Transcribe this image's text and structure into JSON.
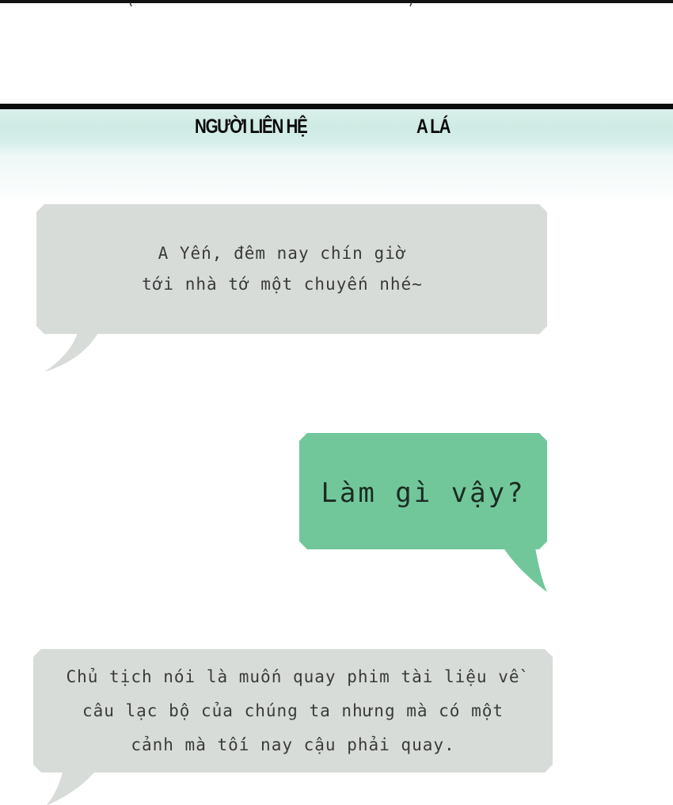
{
  "header": {
    "contact_label": "NGƯỜI LIÊN HỆ",
    "contact_name": "A LÁ"
  },
  "messages": [
    {
      "sender": "contact",
      "text": "A Yến, đêm nay chín giờ\ntới nhà tớ một chuyến nhé~"
    },
    {
      "sender": "self",
      "text": "Làm gì vậy?"
    },
    {
      "sender": "contact",
      "text": "Chủ tịch nói là muốn quay phim tài liệu về\ncâu lạc bộ của chúng ta nhưng mà có một\ncảnh mà tối nay cậu phải quay."
    }
  ],
  "colors": {
    "incoming_bubble": "#d8dcd9",
    "outgoing_bubble": "#71c79a",
    "header_band": "#d9efea",
    "rule": "#0c0c0c"
  }
}
